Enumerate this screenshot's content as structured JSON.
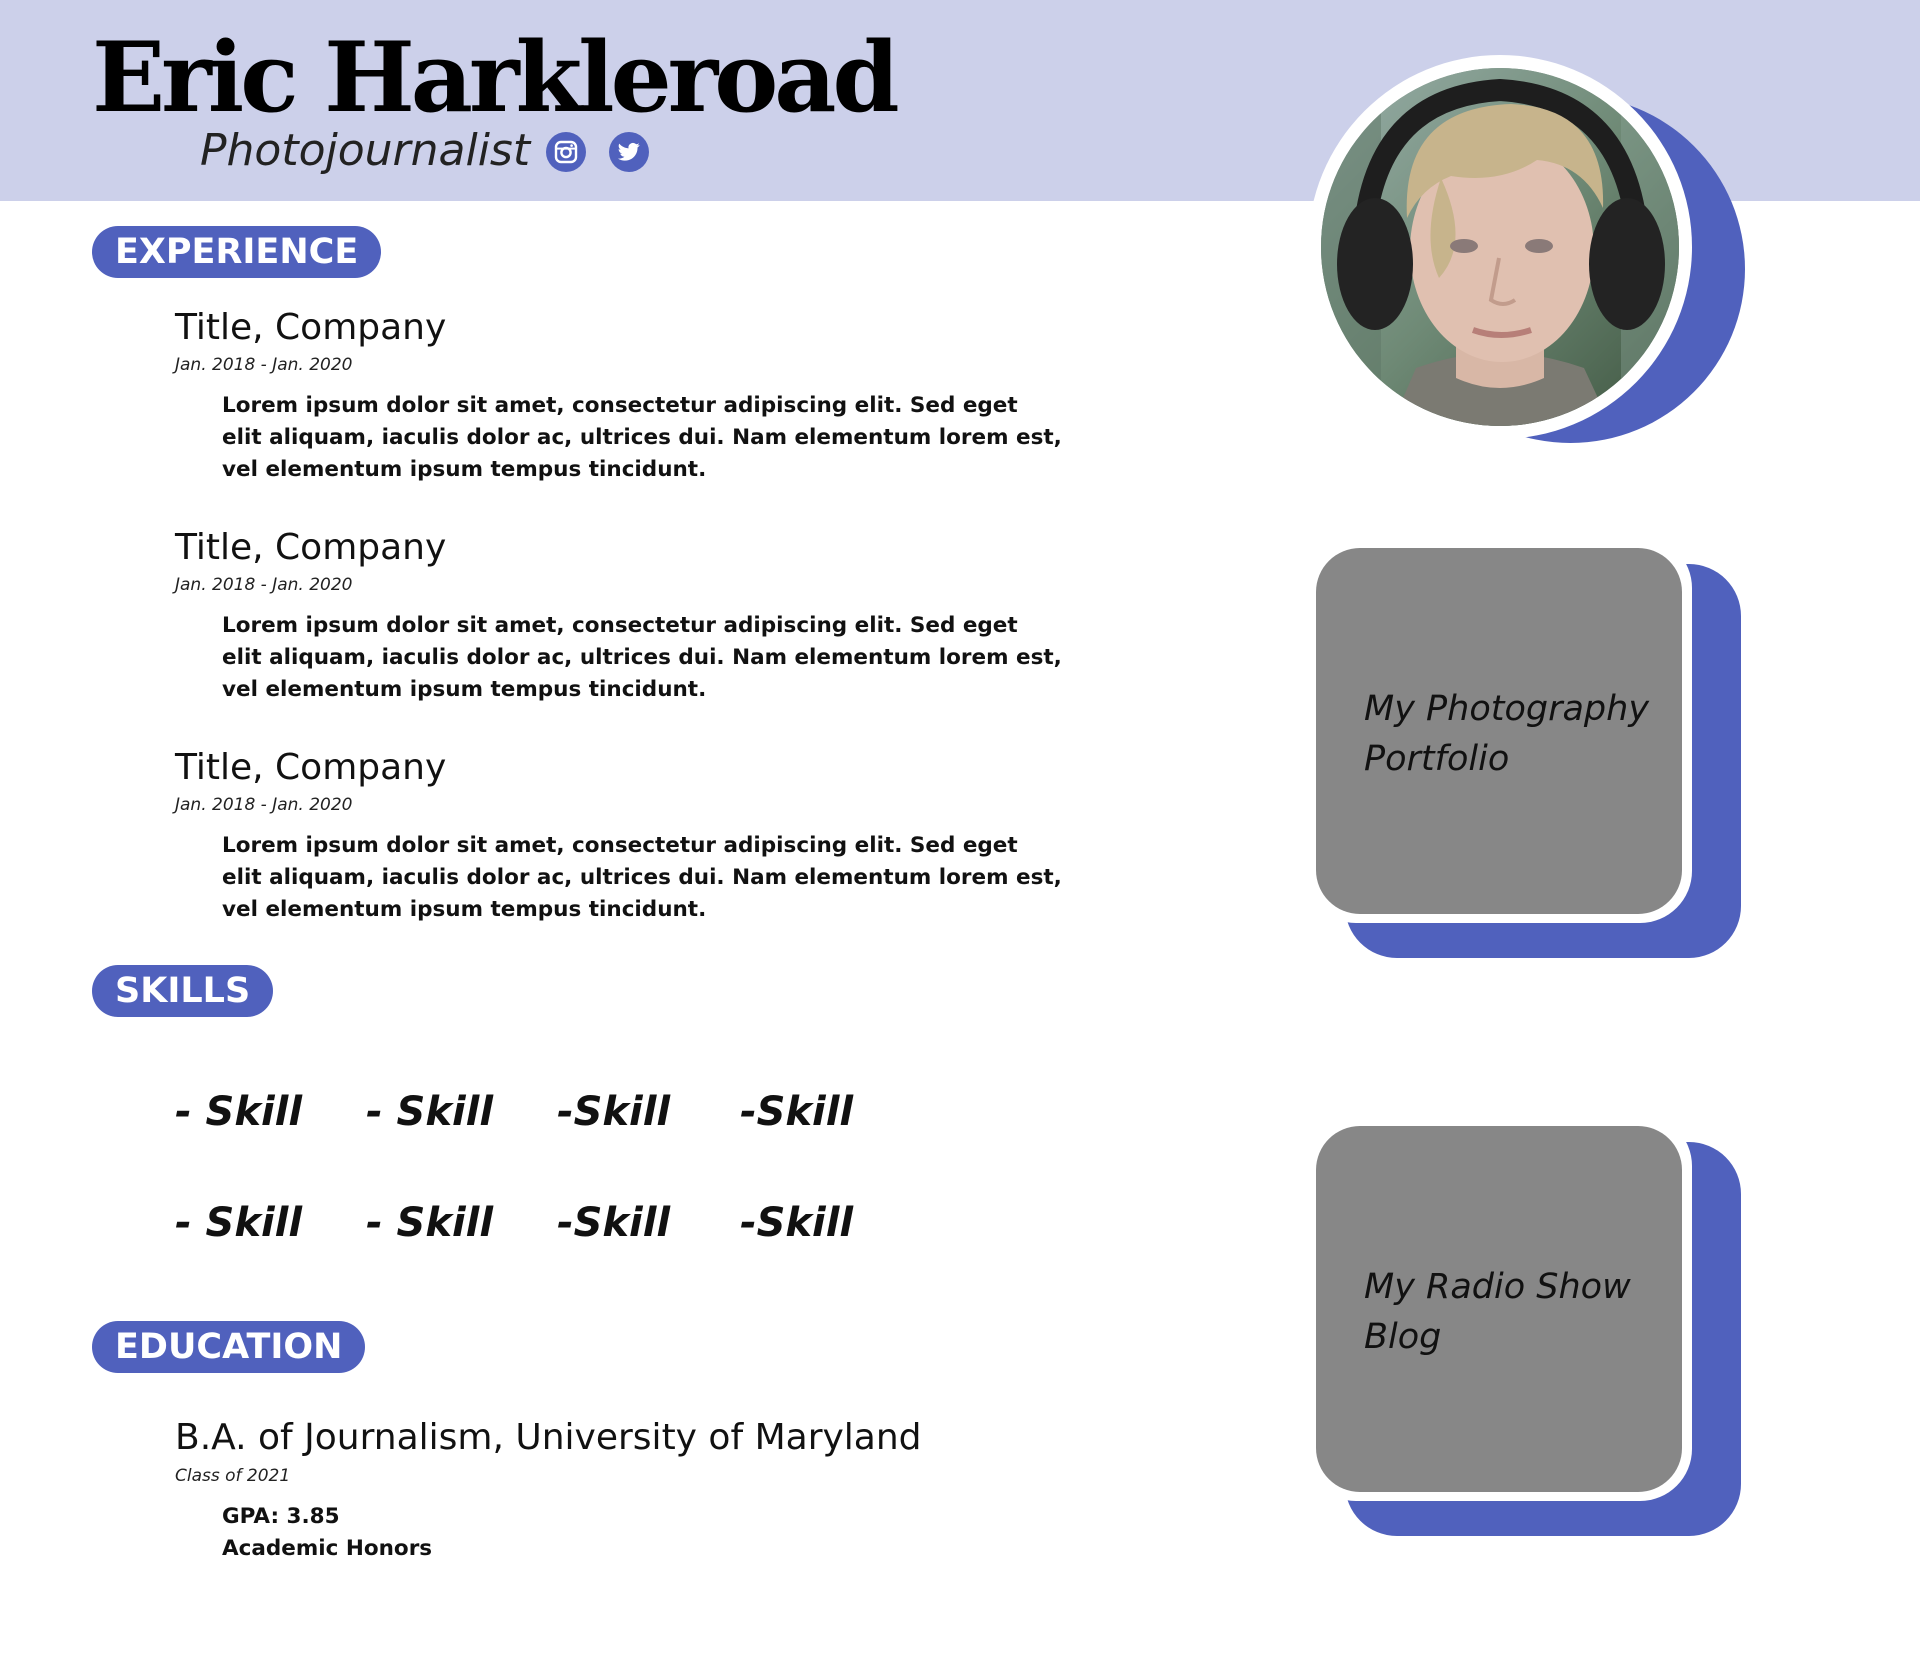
{
  "header": {
    "name": "Eric Harkleroad",
    "role": "Photojournalist",
    "social": [
      {
        "icon": "instagram-icon"
      },
      {
        "icon": "twitter-icon"
      }
    ]
  },
  "experience": {
    "heading": "EXPERIENCE",
    "jobs": [
      {
        "title": "Title, Company",
        "dates": "Jan. 2018 - Jan. 2020",
        "description": "Lorem ipsum dolor sit amet, consectetur adipiscing elit. Sed eget elit aliquam, iaculis dolor ac, ultrices dui. Nam elementum lorem est, vel elementum ipsum tempus tincidunt."
      },
      {
        "title": "Title, Company",
        "dates": "Jan. 2018 - Jan. 2020",
        "description": "Lorem ipsum dolor sit amet, consectetur adipiscing elit. Sed eget elit aliquam, iaculis dolor ac, ultrices dui. Nam elementum lorem est, vel elementum ipsum tempus tincidunt."
      },
      {
        "title": "Title, Company",
        "dates": "Jan. 2018 - Jan. 2020",
        "description": "Lorem ipsum dolor sit amet, consectetur adipiscing elit. Sed eget elit aliquam, iaculis dolor ac, ultrices dui. Nam elementum lorem est, vel elementum ipsum tempus tincidunt."
      }
    ]
  },
  "skills": {
    "heading": "SKILLS",
    "rows": [
      [
        "- Skill",
        "- Skill",
        "-Skill",
        "-Skill"
      ],
      [
        "- Skill",
        "- Skill",
        "-Skill",
        "-Skill"
      ]
    ]
  },
  "education": {
    "heading": "EDUCATION",
    "degree": "B.A. of Journalism, University of Maryland",
    "class_of": "Class of 2021",
    "details": [
      "GPA: 3.85",
      "Academic Honors"
    ]
  },
  "links": [
    {
      "line1": "My Photography",
      "line2": "Portfolio"
    },
    {
      "line1": "My Radio Show",
      "line2": "Blog"
    }
  ],
  "colors": {
    "banner": "#ccd0ea",
    "accent": "#5061bd",
    "card": "#878787"
  }
}
